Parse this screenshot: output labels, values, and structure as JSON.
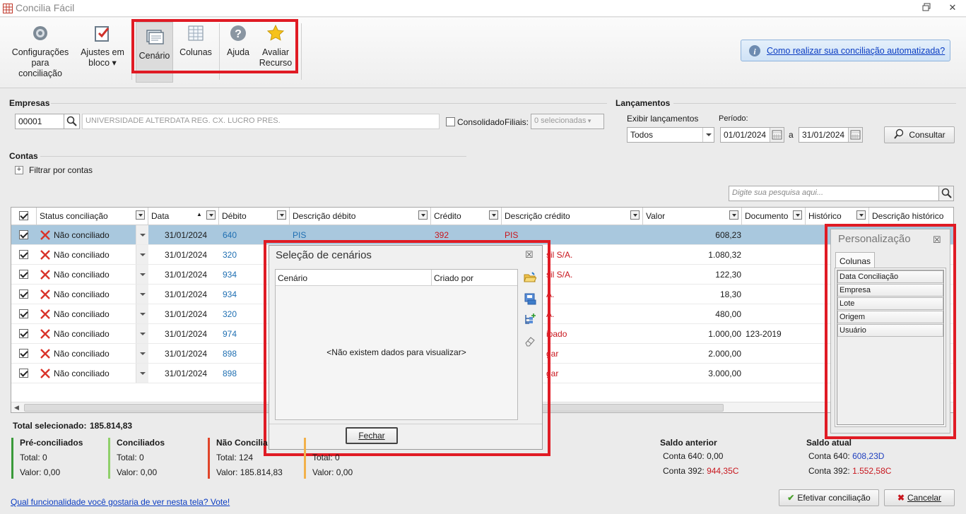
{
  "window": {
    "title": "Concilia Fácil"
  },
  "ribbon": {
    "config": "Configurações para conciliação",
    "ajustes": "Ajustes em bloco",
    "ajustes_arrow": "▾",
    "cenario": "Cenário",
    "colunas": "Colunas",
    "ajuda": "Ajuda",
    "avaliar": "Avaliar Recurso",
    "help_link": "Como realizar sua conciliação automatizada?"
  },
  "empresas": {
    "label": "Empresas",
    "code": "00001",
    "name": "UNIVERSIDADE ALTERDATA REG. CX. LUCRO PRES.",
    "consolidado": "Consolidado",
    "filiais_label": "Filiais:",
    "filiais_value": "0 selecionadas"
  },
  "lancamentos": {
    "label": "Lançamentos",
    "exibir_label": "Exibir lançamentos",
    "exibir_value": "Todos",
    "periodo_label": "Período:",
    "date_from": "01/01/2024",
    "a": "a",
    "date_to": "31/01/2024",
    "consultar": "Consultar"
  },
  "contas": {
    "label": "Contas",
    "filter": "Filtrar por contas",
    "filter_icon": "+"
  },
  "search": {
    "placeholder": "Digite sua pesquisa aqui..."
  },
  "grid": {
    "headers": [
      "Status conciliação",
      "Data",
      "Débito",
      "Descrição débito",
      "Crédito",
      "Descrição crédito",
      "Valor",
      "Documento",
      "Histórico",
      "Descrição histórico"
    ],
    "rows": [
      {
        "status": "Não conciliado",
        "data": "31/01/2024",
        "debito": "640",
        "desc_debito": "PIS",
        "credito": "392",
        "desc_credito": "PIS",
        "valor": "608,23",
        "documento": ""
      },
      {
        "status": "Não conciliado",
        "data": "31/01/2024",
        "debito": "320",
        "desc_debito": "",
        "credito": "",
        "desc_credito": "sil S/A.",
        "valor": "1.080,32",
        "documento": ""
      },
      {
        "status": "Não conciliado",
        "data": "31/01/2024",
        "debito": "934",
        "desc_debito": "",
        "credito": "",
        "desc_credito": "sil S/A.",
        "valor": "122,30",
        "documento": ""
      },
      {
        "status": "Não conciliado",
        "data": "31/01/2024",
        "debito": "934",
        "desc_debito": "",
        "credito": "",
        "desc_credito": "A.",
        "valor": "18,30",
        "documento": ""
      },
      {
        "status": "Não conciliado",
        "data": "31/01/2024",
        "debito": "320",
        "desc_debito": "",
        "credito": "",
        "desc_credito": "A.",
        "valor": "480,00",
        "documento": ""
      },
      {
        "status": "Não conciliado",
        "data": "31/01/2024",
        "debito": "974",
        "desc_debito": "",
        "credito": "",
        "desc_credito": "ipado",
        "valor": "1.000,00",
        "documento": "123-2019"
      },
      {
        "status": "Não conciliado",
        "data": "31/01/2024",
        "debito": "898",
        "desc_debito": "",
        "credito": "",
        "desc_credito": "gar",
        "valor": "2.000,00",
        "documento": ""
      },
      {
        "status": "Não conciliado",
        "data": "31/01/2024",
        "debito": "898",
        "desc_debito": "",
        "credito": "",
        "desc_credito": "gar",
        "valor": "3.000,00",
        "documento": ""
      }
    ]
  },
  "dialog": {
    "title": "Seleção de cenários",
    "col_cenario": "Cenário",
    "col_criado": "Criado por",
    "empty": "<Não existem dados para visualizar>",
    "fechar": "Fechar",
    "close": "☒"
  },
  "personalizacao": {
    "title": "Personalização",
    "tab": "Colunas",
    "items": [
      "Data Conciliação",
      "Empresa",
      "Lote",
      "Origem",
      "Usuário"
    ],
    "close": "☒"
  },
  "totals": {
    "selecionado_label": "Total selecionado:",
    "selecionado_value": "185.814,83",
    "pre": {
      "title": "Pré-conciliados",
      "total": "Total: 0",
      "valor": "Valor: 0,00",
      "color": "#3a9a3a"
    },
    "conc": {
      "title": "Conciliados",
      "total": "Total: 0",
      "valor": "Valor: 0,00",
      "color": "#8fd06a"
    },
    "nao": {
      "title": "Não Concilia",
      "total": "Total: 124",
      "valor": "Valor: 185.814,83",
      "color": "#e0452a"
    },
    "outro": {
      "total": "Total: 0",
      "valor": "Valor: 0,00",
      "color": "#f2b14a"
    },
    "saldo_anterior": {
      "title": "Saldo anterior",
      "l1_label": "Conta 640:",
      "l1_val": "0,00",
      "l2_label": "Conta 392:",
      "l2_val": "944,35C"
    },
    "saldo_atual": {
      "title": "Saldo atual",
      "l1_label": "Conta 640:",
      "l1_val": "608,23D",
      "l2_label": "Conta 392:",
      "l2_val": "1.552,58C"
    }
  },
  "footer": {
    "vote": "Qual funcionalidade você gostaria de ver nesta tela? Vote!",
    "efetivar": "Efetivar conciliação",
    "cancelar": "Cancelar"
  }
}
